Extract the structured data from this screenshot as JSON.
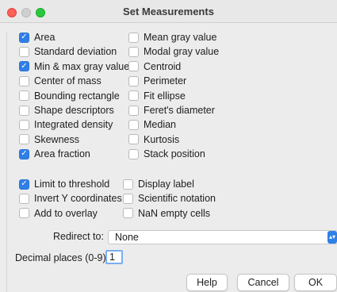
{
  "window": {
    "title": "Set Measurements"
  },
  "left_column": [
    {
      "label": "Area",
      "checked": true
    },
    {
      "label": "Standard deviation",
      "checked": false
    },
    {
      "label": "Min & max gray value",
      "checked": true
    },
    {
      "label": "Center of mass",
      "checked": false
    },
    {
      "label": "Bounding rectangle",
      "checked": false
    },
    {
      "label": "Shape descriptors",
      "checked": false
    },
    {
      "label": "Integrated density",
      "checked": false
    },
    {
      "label": "Skewness",
      "checked": false
    },
    {
      "label": "Area fraction",
      "checked": true
    }
  ],
  "right_column": [
    {
      "label": "Mean gray value",
      "checked": false
    },
    {
      "label": "Modal gray value",
      "checked": false
    },
    {
      "label": "Centroid",
      "checked": false
    },
    {
      "label": "Perimeter",
      "checked": false
    },
    {
      "label": "Fit ellipse",
      "checked": false
    },
    {
      "label": "Feret's diameter",
      "checked": false
    },
    {
      "label": "Median",
      "checked": false
    },
    {
      "label": "Kurtosis",
      "checked": false
    },
    {
      "label": "Stack position",
      "checked": false
    }
  ],
  "options_left": [
    {
      "label": "Limit to threshold",
      "checked": true
    },
    {
      "label": "Invert Y coordinates",
      "checked": false
    },
    {
      "label": "Add to overlay",
      "checked": false
    }
  ],
  "options_right": [
    {
      "label": "Display label",
      "checked": false
    },
    {
      "label": "Scientific notation",
      "checked": false
    },
    {
      "label": "NaN empty cells",
      "checked": false
    }
  ],
  "redirect": {
    "label": "Redirect to:",
    "value": "None"
  },
  "decimal": {
    "label": "Decimal places (0-9):",
    "value": "1"
  },
  "buttons": {
    "help": "Help",
    "cancel": "Cancel",
    "ok": "OK"
  },
  "colors": {
    "accent": "#2f7fe7",
    "close": "#fe5f57",
    "maximize": "#28c840"
  }
}
